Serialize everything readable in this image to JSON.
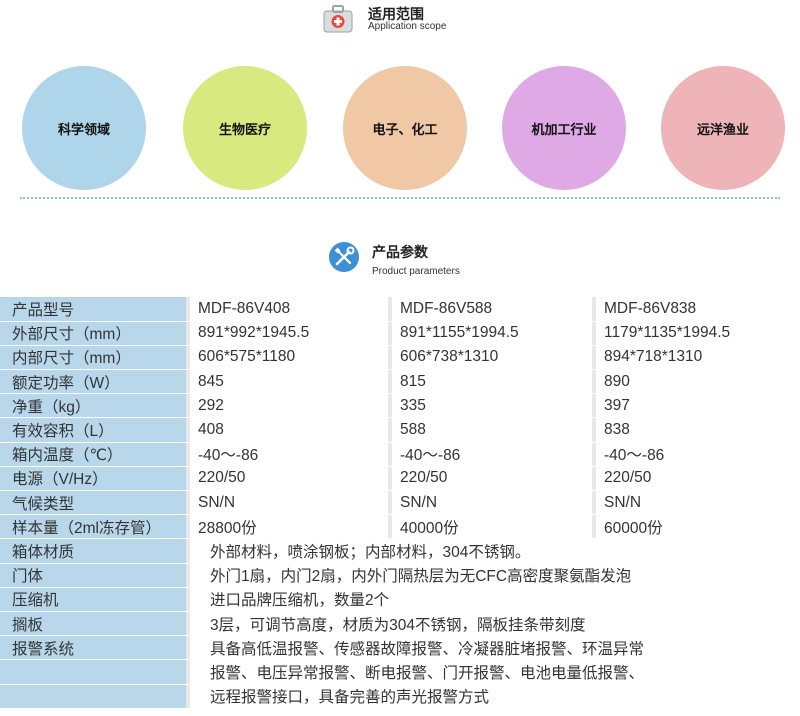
{
  "scope": {
    "title": "适用范围",
    "subtitle": "Application scope",
    "icon": "medical-kit-icon",
    "items": [
      {
        "label": "科学领域",
        "color": "#aed5ea"
      },
      {
        "label": "生物医疗",
        "color": "#d8e97f"
      },
      {
        "label": "电子、化工",
        "color": "#f0c8a6"
      },
      {
        "label": "机加工行业",
        "color": "#dea9e5"
      },
      {
        "label": "远洋渔业",
        "color": "#eeb4b7"
      }
    ]
  },
  "params": {
    "title": "产品参数",
    "subtitle": "Product parameters",
    "icon": "tools-icon",
    "rows": [
      {
        "label": "产品型号",
        "values": [
          "MDF-86V408",
          "MDF-86V588",
          "MDF-86V838"
        ]
      },
      {
        "label": "外部尺寸（mm）",
        "values": [
          "891*992*1945.5",
          "891*1155*1994.5",
          "1179*1135*1994.5"
        ]
      },
      {
        "label": "内部尺寸（mm）",
        "values": [
          "606*575*1180",
          "606*738*1310",
          "894*718*1310"
        ]
      },
      {
        "label": "额定功率（W）",
        "values": [
          "845",
          "815",
          "890"
        ]
      },
      {
        "label": "净重（kg）",
        "values": [
          "292",
          "335",
          "397"
        ]
      },
      {
        "label": "有效容积（L）",
        "values": [
          "408",
          "588",
          "838"
        ]
      },
      {
        "label": "箱内温度（℃）",
        "values": [
          "-40～-86",
          "-40～-86",
          "-40～-86"
        ]
      },
      {
        "label": "电源（V/Hz）",
        "values": [
          "220/50",
          "220/50",
          "220/50"
        ]
      },
      {
        "label": "气候类型",
        "values": [
          "SN/N",
          "SN/N",
          "SN/N"
        ]
      },
      {
        "label": "样本量（2ml冻存管）",
        "values": [
          "28800份",
          "40000份",
          "60000份"
        ]
      }
    ],
    "wide_rows": [
      {
        "label": "箱体材质",
        "value": "外部材料，喷涂钢板；内部材料，304不锈钢。"
      },
      {
        "label": "门体",
        "value": "外门1扇，内门2扇，内外门隔热层为无CFC高密度聚氨酯发泡"
      },
      {
        "label": "压缩机",
        "value": "进口品牌压缩机，数量2个"
      },
      {
        "label": "搁板",
        "value": "3层，可调节高度，材质为304不锈钢，隔板挂条带刻度"
      }
    ],
    "alarm": {
      "label": "报警系统",
      "lines": [
        "具备高低温报警、传感器故障报警、冷凝器脏堵报警、环温异常",
        "报警、电压异常报警、断电报警、门开报警、电池电量低报警、",
        "远程报警接口，具备完善的声光报警方式"
      ]
    }
  }
}
